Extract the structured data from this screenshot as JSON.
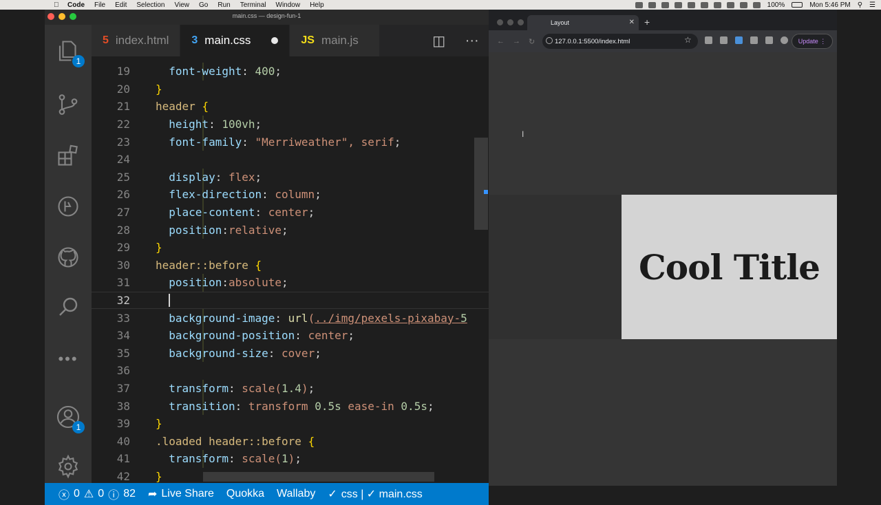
{
  "menubar": {
    "app": "Code",
    "items": [
      "File",
      "Edit",
      "Selection",
      "View",
      "Go",
      "Run",
      "Terminal",
      "Window",
      "Help"
    ],
    "battery": "100%",
    "clock": "Mon 5:46 PM"
  },
  "vscode": {
    "window_title": "main.css — design-fun-1",
    "tabs": [
      {
        "icon": "html-file-icon",
        "label": "index.html"
      },
      {
        "icon": "css-file-icon",
        "label": "main.css"
      },
      {
        "icon": "js-file-icon",
        "label": "main.js",
        "prefix": "JS"
      }
    ],
    "activity_badges": {
      "explorer": "1",
      "accounts": "1"
    },
    "code_lines": [
      {
        "n": "19",
        "text": "  font-weight: 400;"
      },
      {
        "n": "20",
        "text": "}"
      },
      {
        "n": "21",
        "text": "header {"
      },
      {
        "n": "22",
        "text": "  height: 100vh;"
      },
      {
        "n": "23",
        "text": "  font-family: \"Merriweather\", serif;"
      },
      {
        "n": "24",
        "text": ""
      },
      {
        "n": "25",
        "text": "  display: flex;"
      },
      {
        "n": "26",
        "text": "  flex-direction: column;"
      },
      {
        "n": "27",
        "text": "  place-content: center;"
      },
      {
        "n": "28",
        "text": "  position:relative;"
      },
      {
        "n": "29",
        "text": "}"
      },
      {
        "n": "30",
        "text": "header::before {"
      },
      {
        "n": "31",
        "text": "  position:absolute;"
      },
      {
        "n": "32",
        "text": "  "
      },
      {
        "n": "33",
        "text": "  background-image: url(../img/pexels-pixabay-5"
      },
      {
        "n": "34",
        "text": "  background-position: center;"
      },
      {
        "n": "35",
        "text": "  background-size: cover;"
      },
      {
        "n": "36",
        "text": ""
      },
      {
        "n": "37",
        "text": "  transform: scale(1.4);"
      },
      {
        "n": "38",
        "text": "  transition: transform 0.5s ease-in 0.5s;"
      },
      {
        "n": "39",
        "text": "}"
      },
      {
        "n": "40",
        "text": ".loaded header::before {"
      },
      {
        "n": "41",
        "text": "  transform: scale(1);"
      },
      {
        "n": "42",
        "text": "}"
      }
    ],
    "status": {
      "errors": "0",
      "warnings": "0",
      "info": "82",
      "live_share": "Live Share",
      "quokka": "Quokka",
      "wallaby": "Wallaby",
      "lang": "css | ✓ main.css"
    }
  },
  "browser": {
    "tab_title": "Layout",
    "url": "127.0.0.1:5500/index.html",
    "update_label": "Update",
    "hero_title": "Cool Title"
  }
}
